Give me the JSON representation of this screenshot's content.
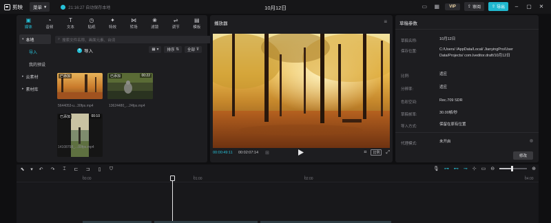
{
  "titlebar": {
    "app_name": "剪映",
    "menu_label": "菜单",
    "autosave_text": "21:16:27 自动保存本地",
    "document_title": "10月12日",
    "vip_label": "VIP",
    "share_label": "审阅",
    "export_label": "导出",
    "icons": [
      "screen-icon",
      "layout-icon",
      "minimize-icon",
      "maximize-icon",
      "close-icon"
    ]
  },
  "media": {
    "tools": [
      {
        "icon": "media-icon",
        "label": "媒体",
        "active": true
      },
      {
        "icon": "audio-icon",
        "label": "音频",
        "active": false
      },
      {
        "icon": "text-icon",
        "label": "文本",
        "active": false
      },
      {
        "icon": "sticker-icon",
        "label": "贴纸",
        "active": false
      },
      {
        "icon": "effects-icon",
        "label": "特效",
        "active": false
      },
      {
        "icon": "transition-icon",
        "label": "转场",
        "active": false
      },
      {
        "icon": "filter-icon",
        "label": "滤镜",
        "active": false
      },
      {
        "icon": "adjust-icon",
        "label": "调节",
        "active": false
      },
      {
        "icon": "template-icon",
        "label": "模板",
        "active": false
      }
    ],
    "nav": {
      "local": "本地",
      "import": "导入",
      "my_presets": "我的预设",
      "cloud": "云素材",
      "library": "素材库"
    },
    "search_placeholder": "搜索文件名称、画面元素、台词",
    "import_label": "导入",
    "sort_label": "排序",
    "filter_label": "全部",
    "all_label": "全部",
    "clips": [
      {
        "badge": "已添加",
        "duration": "",
        "name": "5644053-u...30fps.mp4"
      },
      {
        "badge": "已添加",
        "duration": "00:22",
        "name": "13624480_...24fps.mp4"
      },
      {
        "badge": "已添加",
        "duration": "00:10",
        "name": "14108798_...00fps.mp4"
      }
    ]
  },
  "player": {
    "title": "播放器",
    "time_current": "00:00:49:11",
    "time_total": "00:02:07:14",
    "ratio_label": "比例"
  },
  "props": {
    "title": "草稿参数",
    "rows": [
      {
        "label": "草稿名称:",
        "value": "10月12日"
      },
      {
        "label": "保存位置:",
        "value": "C:/Users/        /AppData/Local/ JianyingPro/User Data/Projects/ com.lveditor.draft/10月12日"
      },
      {
        "label": "比例:",
        "value": "适应"
      },
      {
        "label": "分辨率:",
        "value": "适应"
      },
      {
        "label": "色彩空间:",
        "value": "Rec.709 SDR"
      },
      {
        "label": "草稿帧率:",
        "value": "30.00帧/秒"
      },
      {
        "label": "导入方式:",
        "value": "保留在原有位置"
      },
      {
        "label": "代理模式:",
        "value": "未开启"
      }
    ],
    "modify_label": "修改"
  },
  "timeline": {
    "ticks": [
      "00:00",
      "01:00",
      "02:00",
      "04:00"
    ],
    "zoom_level": 0.45
  },
  "colors": {
    "accent": "#27c1d8",
    "panel": "#1d1d20",
    "background": "#0f0f11"
  }
}
